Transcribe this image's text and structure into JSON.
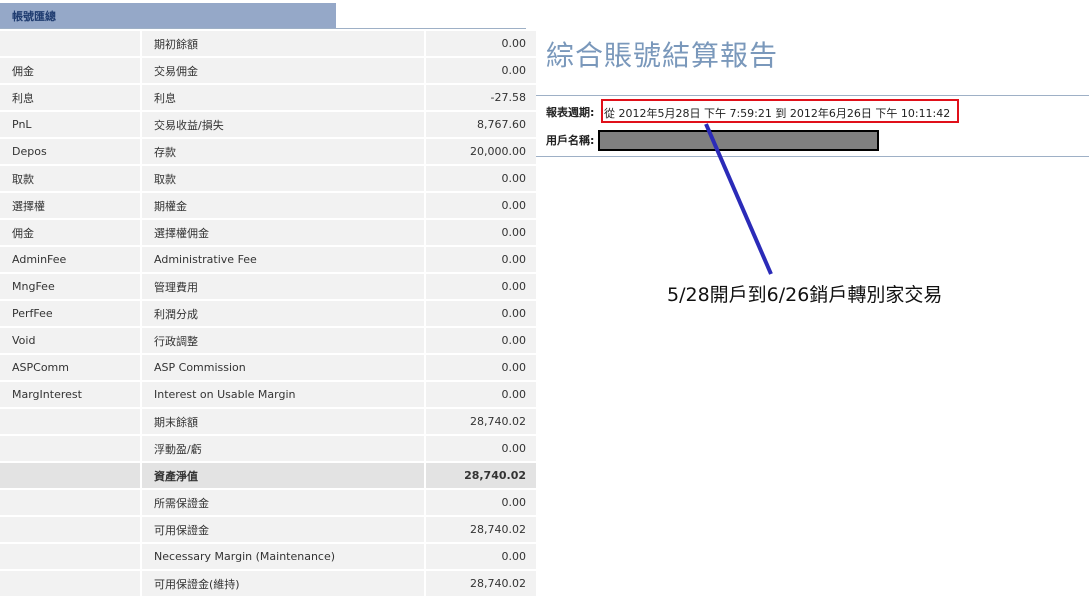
{
  "summary": {
    "tab_title": "帳號匯總",
    "rows": [
      {
        "code": "",
        "label": "期初餘額",
        "value": "0.00"
      },
      {
        "code": "佣金",
        "label": "交易佣金",
        "value": "0.00"
      },
      {
        "code": "利息",
        "label": "利息",
        "value": "-27.58"
      },
      {
        "code": "PnL",
        "label": "交易收益/損失",
        "value": "8,767.60"
      },
      {
        "code": "Depos",
        "label": "存款",
        "value": "20,000.00"
      },
      {
        "code": "取款",
        "label": "取款",
        "value": "0.00"
      },
      {
        "code": "選擇權",
        "label": "期權金",
        "value": "0.00"
      },
      {
        "code": "佣金",
        "label": "選擇權佣金",
        "value": "0.00"
      },
      {
        "code": "AdminFee",
        "label": "Administrative Fee",
        "value": "0.00"
      },
      {
        "code": "MngFee",
        "label": "管理費用",
        "value": "0.00"
      },
      {
        "code": "PerfFee",
        "label": "利潤分成",
        "value": "0.00"
      },
      {
        "code": "Void",
        "label": "行政調整",
        "value": "0.00"
      },
      {
        "code": "ASPComm",
        "label": "ASP Commission",
        "value": "0.00"
      },
      {
        "code": "MargInterest",
        "label": "Interest on Usable Margin",
        "value": "0.00"
      },
      {
        "code": "",
        "label": "期末餘額",
        "value": "28,740.02"
      },
      {
        "code": "",
        "label": "浮動盈/虧",
        "value": "0.00"
      },
      {
        "code": "",
        "label": "資產淨值",
        "value": "28,740.02",
        "total": true
      },
      {
        "code": "",
        "label": "所需保證金",
        "value": "0.00"
      },
      {
        "code": "",
        "label": "可用保證金",
        "value": "28,740.02"
      },
      {
        "code": "",
        "label": "Necessary Margin (Maintenance)",
        "value": "0.00"
      },
      {
        "code": "",
        "label": "可用保證金(維持)",
        "value": "28,740.02"
      }
    ]
  },
  "report": {
    "title": "綜合賬號結算報告",
    "period_label": "報表週期:",
    "period_value": "從 2012年5月28日 下午 7:59:21 到 2012年6月26日 下午 10:11:42",
    "user_label": "用戶名稱:"
  },
  "annotation": {
    "text": "5/28開戶到6/26銷戶轉別家交易",
    "box_color": "#e0101a",
    "line_color": "#2b2bb8"
  }
}
